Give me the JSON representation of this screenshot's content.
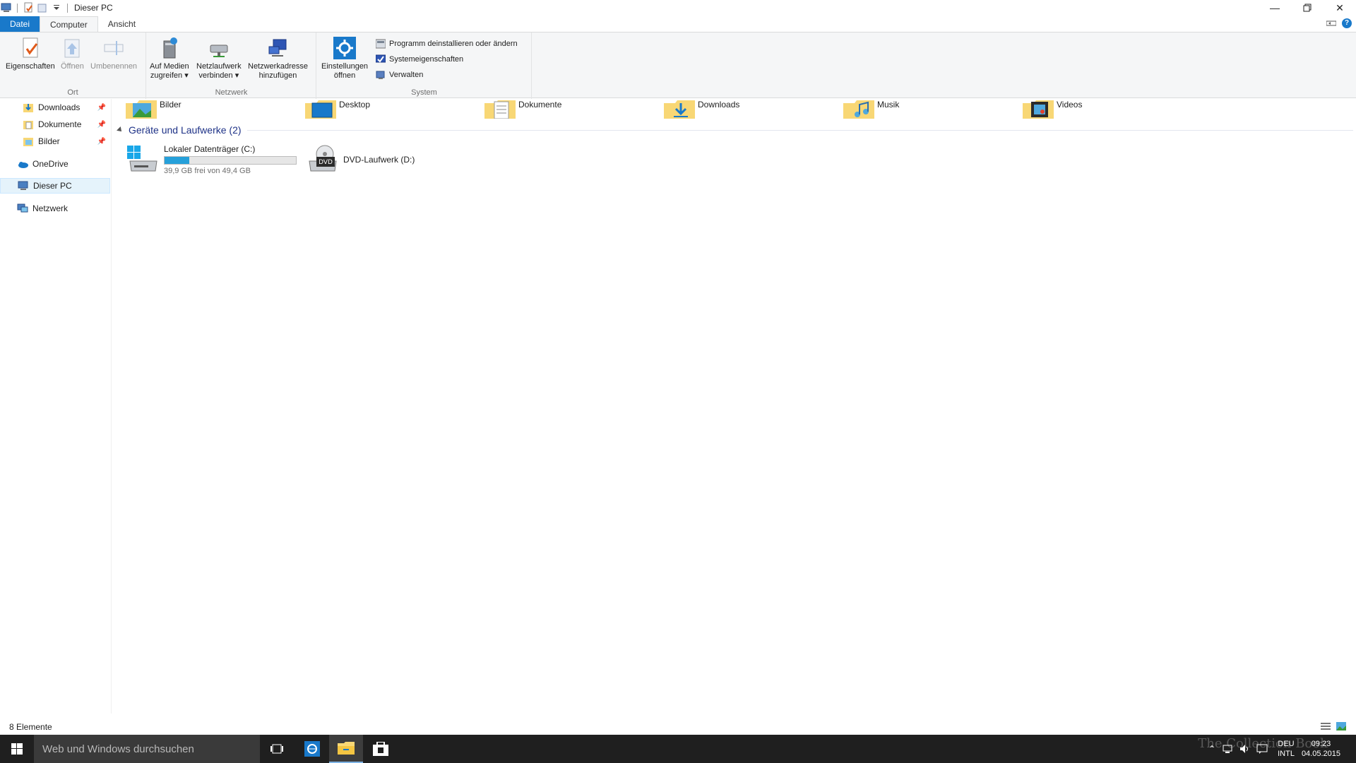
{
  "window": {
    "title": "Dieser PC"
  },
  "tabs": [
    {
      "label": "Datei"
    },
    {
      "label": "Computer"
    },
    {
      "label": "Ansicht"
    }
  ],
  "ribbon": {
    "ort": {
      "label": "Ort",
      "eigenschaften": "Eigenschaften",
      "oeffnen": "Öffnen",
      "umbenennen": "Umbenennen"
    },
    "netzwerk": {
      "label": "Netzwerk",
      "medien_1": "Auf Medien",
      "medien_2": "zugreifen",
      "laufwerk_1": "Netzlaufwerk",
      "laufwerk_2": "verbinden",
      "adresse_1": "Netzwerkadresse",
      "adresse_2": "hinzufügen"
    },
    "system": {
      "label": "System",
      "einstellungen_1": "Einstellungen",
      "einstellungen_2": "öffnen",
      "programm": "Programm deinstallieren oder ändern",
      "systemeigenschaften": "Systemeigenschaften",
      "verwalten": "Verwalten"
    }
  },
  "nav": {
    "items": [
      {
        "label": "Downloads",
        "pinned": true
      },
      {
        "label": "Dokumente",
        "pinned": true
      },
      {
        "label": "Bilder",
        "pinned": true
      },
      {
        "label": "OneDrive"
      },
      {
        "label": "Dieser PC"
      },
      {
        "label": "Netzwerk"
      }
    ]
  },
  "folders": [
    {
      "label": "Bilder"
    },
    {
      "label": "Desktop"
    },
    {
      "label": "Dokumente"
    },
    {
      "label": "Downloads"
    },
    {
      "label": "Musik"
    },
    {
      "label": "Videos"
    }
  ],
  "devices": {
    "heading": "Geräte und Laufwerke (2)",
    "drives": [
      {
        "name": "Lokaler Datenträger (C:)",
        "free": "39,9 GB frei von 49,4 GB",
        "used_fraction": 0.19
      },
      {
        "name": "DVD-Laufwerk (D:)",
        "badge": "DVD"
      }
    ]
  },
  "status": {
    "count": "8 Elemente"
  },
  "taskbar": {
    "search_placeholder": "Web und Windows durchsuchen",
    "lang_1": "DEU",
    "lang_2": "INTL",
    "time": "09:23",
    "date": "04.05.2015",
    "watermark": "The Collection Book"
  },
  "colors": {
    "accent": "#1979ca",
    "drive_fill": "#26a0da",
    "folder": "#f8d775",
    "taskbar": "#1f1f1f"
  }
}
